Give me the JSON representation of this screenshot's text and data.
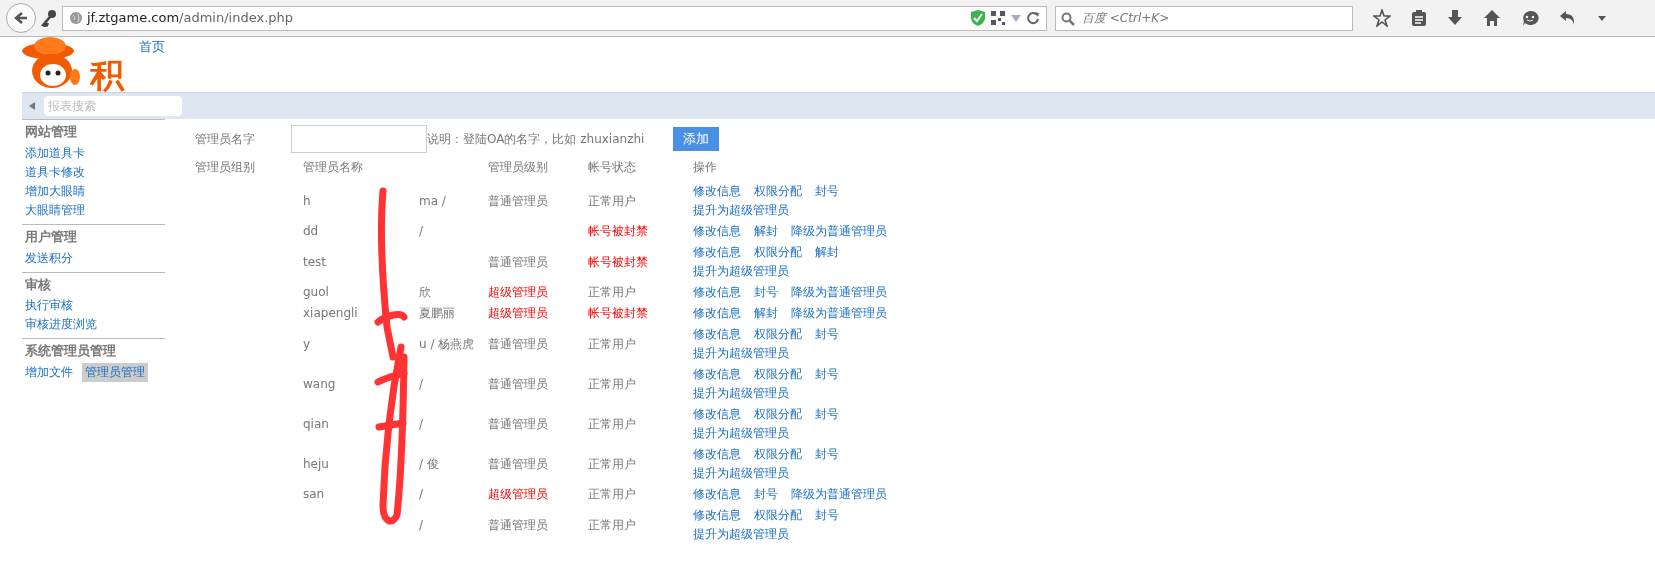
{
  "browser": {
    "url_host": "jf.ztgame.com",
    "url_path": "/admin/index.php",
    "search_placeholder": "百度 <Ctrl+K>"
  },
  "header": {
    "logo_text": "积",
    "nav": [
      {
        "label": "首页"
      }
    ]
  },
  "report_search": {
    "placeholder": "报表搜索"
  },
  "sidebar": [
    {
      "title": "网站管理",
      "items": [
        {
          "label": "添加道具卡",
          "selected": false
        },
        {
          "label": "道具卡修改",
          "selected": false
        },
        {
          "label": "增加大眼睛",
          "selected": false
        },
        {
          "label": "大眼睛管理",
          "selected": false
        }
      ]
    },
    {
      "title": "用户管理",
      "items": [
        {
          "label": "发送积分",
          "selected": false
        }
      ]
    },
    {
      "title": "审核",
      "items": [
        {
          "label": "执行审核",
          "selected": false
        },
        {
          "label": "审核进度浏览",
          "selected": false
        }
      ]
    },
    {
      "title": "系统管理员管理",
      "items": [
        {
          "label": "增加文件",
          "selected": false
        },
        {
          "label": "管理员管理",
          "selected": true
        }
      ]
    }
  ],
  "form": {
    "label": "管理员名字",
    "hint": "说明：登陆OA的名字，比如 zhuxianzhi",
    "button": "添加"
  },
  "table": {
    "columns": [
      "管理员组别",
      "管理员名称",
      "管理员级别",
      "帐号状态",
      "操作"
    ],
    "rows": [
      {
        "name": {
          "left": "h",
          "right": "ma /"
        },
        "level": "普通管理员",
        "super_admin": false,
        "status": "正常用户",
        "banned": false,
        "actions": [
          "修改信息",
          "权限分配",
          "封号",
          "提升为超级管理员"
        ]
      },
      {
        "name": {
          "left": "dd",
          "right": "/"
        },
        "status": "帐号被封禁",
        "banned": true,
        "actions": [
          "修改信息",
          "解封",
          "降级为普通管理员"
        ]
      },
      {
        "name": {
          "left": "test"
        },
        "level": "普通管理员",
        "super_admin": false,
        "status": "帐号被封禁",
        "banned": true,
        "actions": [
          "修改信息",
          "权限分配",
          "解封",
          "提升为超级管理员"
        ]
      },
      {
        "name": {
          "left": "guol",
          "right": "欣"
        },
        "level": "超级管理员",
        "super_admin": true,
        "status": "正常用户",
        "banned": false,
        "actions": [
          "修改信息",
          "封号",
          "降级为普通管理员"
        ]
      },
      {
        "name": {
          "left": "xiapengli",
          "right": "夏鹏丽"
        },
        "level": "超级管理员",
        "super_admin": true,
        "status": "帐号被封禁",
        "banned": true,
        "actions": [
          "修改信息",
          "解封",
          "降级为普通管理员"
        ]
      },
      {
        "name": {
          "left": "y",
          "right": "u / 杨燕虎"
        },
        "level": "普通管理员",
        "super_admin": false,
        "status": "正常用户",
        "banned": false,
        "actions": [
          "修改信息",
          "权限分配",
          "封号",
          "提升为超级管理员"
        ]
      },
      {
        "name": {
          "left": "wang",
          "right": "/"
        },
        "level": "普通管理员",
        "super_admin": false,
        "status": "正常用户",
        "banned": false,
        "actions": [
          "修改信息",
          "权限分配",
          "封号",
          "提升为超级管理员"
        ]
      },
      {
        "name": {
          "left": "qian",
          "right": "/"
        },
        "level": "普通管理员",
        "super_admin": false,
        "status": "正常用户",
        "banned": false,
        "actions": [
          "修改信息",
          "权限分配",
          "封号",
          "提升为超级管理员"
        ]
      },
      {
        "name": {
          "left": "heju",
          "right": "/ 俊"
        },
        "level": "普通管理员",
        "super_admin": false,
        "status": "正常用户",
        "banned": false,
        "actions": [
          "修改信息",
          "权限分配",
          "封号",
          "提升为超级管理员"
        ]
      },
      {
        "name": {
          "left": "san",
          "right": "/"
        },
        "level": "超级管理员",
        "super_admin": true,
        "status": "正常用户",
        "banned": false,
        "actions": [
          "修改信息",
          "封号",
          "降级为普通管理员"
        ]
      },
      {
        "name": {
          "right": "/"
        },
        "level": "普通管理员",
        "super_admin": false,
        "status": "正常用户",
        "banned": false,
        "actions": [
          "修改信息",
          "权限分配",
          "封号",
          "提升为超级管理员"
        ]
      }
    ]
  }
}
